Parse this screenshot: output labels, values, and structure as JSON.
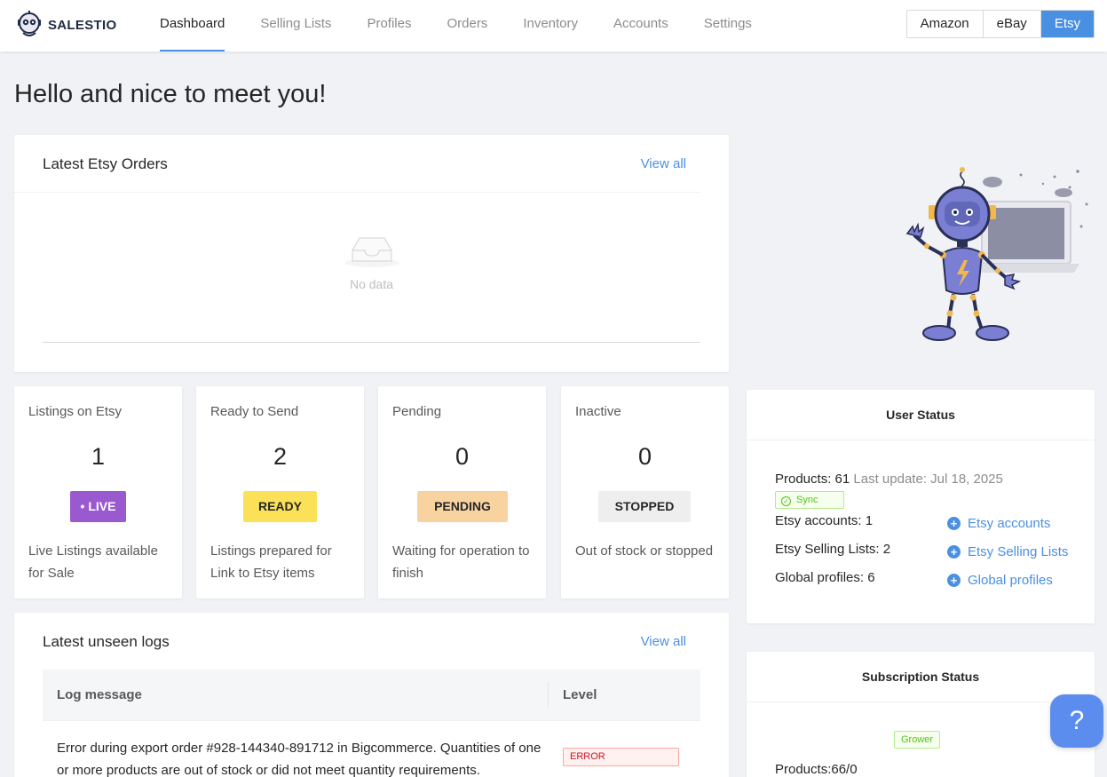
{
  "brand": {
    "name": "SALESTIO"
  },
  "nav": {
    "items": [
      {
        "label": "Dashboard",
        "active": true
      },
      {
        "label": "Selling Lists"
      },
      {
        "label": "Profiles"
      },
      {
        "label": "Orders"
      },
      {
        "label": "Inventory"
      },
      {
        "label": "Accounts"
      },
      {
        "label": "Settings"
      }
    ]
  },
  "marketplaces": [
    {
      "label": "Amazon"
    },
    {
      "label": "eBay"
    },
    {
      "label": "Etsy",
      "active": true
    }
  ],
  "greeting": "Hello and nice to meet you!",
  "orders": {
    "title": "Latest Etsy Orders",
    "view_all": "View all",
    "empty": "No data"
  },
  "stats": [
    {
      "title": "Listings on Etsy",
      "value": "1",
      "badge": "• LIVE",
      "badge_bg": "#9b59d0",
      "badge_fg": "#ffffff",
      "desc": "Live Listings available for Sale"
    },
    {
      "title": "Ready to Send",
      "value": "2",
      "badge": "READY",
      "badge_bg": "#fbe158",
      "badge_fg": "#262626",
      "desc": "Listings prepared for Link to Etsy items"
    },
    {
      "title": "Pending",
      "value": "0",
      "badge": "PENDING",
      "badge_bg": "#f8d3a0",
      "badge_fg": "#262626",
      "desc": "Waiting for operation to finish"
    },
    {
      "title": "Inactive",
      "value": "0",
      "badge": "STOPPED",
      "badge_bg": "#eeeeee",
      "badge_fg": "#262626",
      "desc": "Out of stock or stopped"
    }
  ],
  "user_status": {
    "title": "User Status",
    "products_label": "Products:",
    "products_value": "61",
    "last_update": "Last update: Jul 18, 2025",
    "sync_tag": "Sync",
    "etsy_accounts": "Etsy accounts: 1",
    "etsy_selling_lists": "Etsy Selling Lists: 2",
    "global_profiles": "Global profiles: 6",
    "links": {
      "accounts": "Etsy accounts",
      "selling_lists": "Etsy Selling Lists",
      "profiles": "Global profiles"
    }
  },
  "logs": {
    "title": "Latest unseen logs",
    "view_all": "View all",
    "columns": {
      "message": "Log message",
      "level": "Level"
    },
    "rows": [
      {
        "message": "Error during export order #928-144340-891712 in Bigcommerce. Quantities of one or more products are out of stock or did not meet quantity requirements.",
        "level": "ERROR"
      }
    ]
  },
  "subscription": {
    "title": "Subscription Status",
    "plan": "Grower",
    "products": "Products:66/0"
  },
  "help": {
    "label": "?"
  },
  "colors": {
    "accent": "#4a90e2",
    "robot": "#7a7fd4"
  }
}
